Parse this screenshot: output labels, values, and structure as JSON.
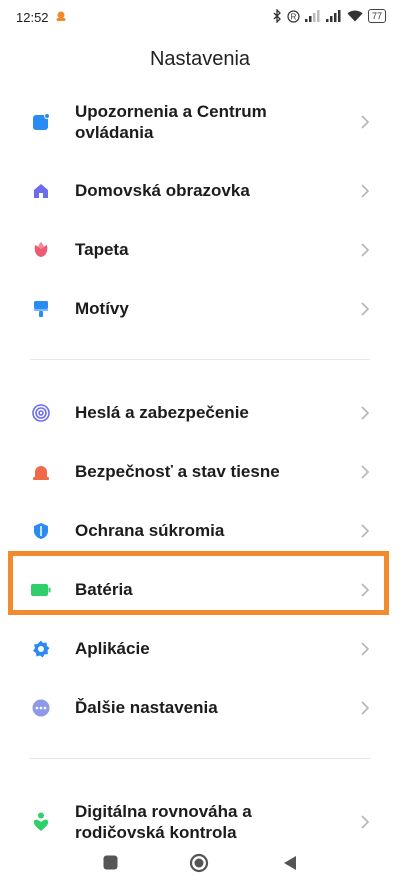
{
  "status": {
    "time": "12:52",
    "battery": "77"
  },
  "header": {
    "title": "Nastavenia"
  },
  "items": [
    {
      "label_line1": "Upozornenia a Centrum",
      "label_line2": "ovládania",
      "icon": "notification-icon",
      "color": "#2a8bf2"
    },
    {
      "label": "Domovská obrazovka",
      "icon": "home-icon",
      "color": "#6b6cf0"
    },
    {
      "label": "Tapeta",
      "icon": "tulip-icon",
      "color": "#ec5a73"
    },
    {
      "label": "Motívy",
      "icon": "brush-icon",
      "color": "#2a8bf2"
    },
    {
      "label": "Heslá a zabezpečenie",
      "icon": "fingerprint-icon",
      "color": "#6b6cf0"
    },
    {
      "label": "Bezpečnosť a stav tiesne",
      "icon": "alarm-icon",
      "color": "#f06a4a"
    },
    {
      "label": "Ochrana súkromia",
      "icon": "shield-icon",
      "color": "#2a8bf2"
    },
    {
      "label": "Batéria",
      "icon": "battery-icon",
      "color": "#2fcf6b"
    },
    {
      "label": "Aplikácie",
      "icon": "gear-icon",
      "color": "#2a8bf2"
    },
    {
      "label": "Ďalšie nastavenia",
      "icon": "more-icon",
      "color": "#8e9ae8"
    },
    {
      "label_line1": "Digitálna rovnováha a",
      "label_line2": "rodičovská kontrola",
      "icon": "wellbeing-icon",
      "color": "#2fcf6b"
    }
  ]
}
